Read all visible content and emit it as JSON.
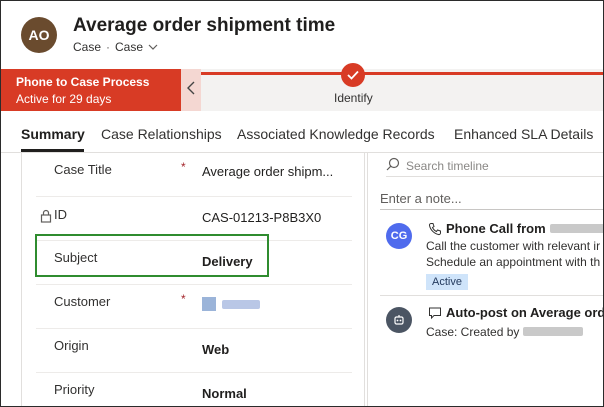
{
  "header": {
    "avatar_initials": "AO",
    "title": "Average order shipment time",
    "entity": "Case",
    "form_name": "Case"
  },
  "process": {
    "name": "Phone to Case Process",
    "status": "Active for 29 days",
    "stage_label": "Identify"
  },
  "tabs": [
    {
      "label": "Summary"
    },
    {
      "label": "Case Relationships"
    },
    {
      "label": "Associated Knowledge Records"
    },
    {
      "label": "Enhanced SLA Details"
    }
  ],
  "form": {
    "fields": [
      {
        "label": "Case Title",
        "value": "Average order shipm..."
      },
      {
        "label": "ID",
        "value": "CAS-01213-P8B3X0"
      },
      {
        "label": "Subject",
        "value": "Delivery"
      },
      {
        "label": "Customer",
        "value": ""
      },
      {
        "label": "Origin",
        "value": "Web"
      },
      {
        "label": "Priority",
        "value": "Normal"
      }
    ]
  },
  "timeline": {
    "search_placeholder": "Search timeline",
    "note_placeholder": "Enter a note...",
    "items": [
      {
        "avatar": "CG",
        "title": "Phone Call from",
        "lines": [
          "Call the customer with relevant ir",
          "Schedule an appointment with th"
        ],
        "badge": "Active"
      },
      {
        "title": "Auto-post on Average order",
        "lines": [
          "Case: Created by"
        ]
      }
    ]
  },
  "colors": {
    "process_accent": "#d83b25",
    "highlight_border": "#2f8c2f",
    "avatar": "#6a4b2e",
    "timeline_avatar_1": "#4f6bed",
    "timeline_avatar_2": "#4b5563"
  },
  "icons": [
    "chevron-down-icon",
    "chevron-left-icon",
    "checkmark-icon",
    "lock-icon",
    "search-icon",
    "phone-call-icon",
    "post-icon",
    "bot-icon",
    "account-icon"
  ]
}
